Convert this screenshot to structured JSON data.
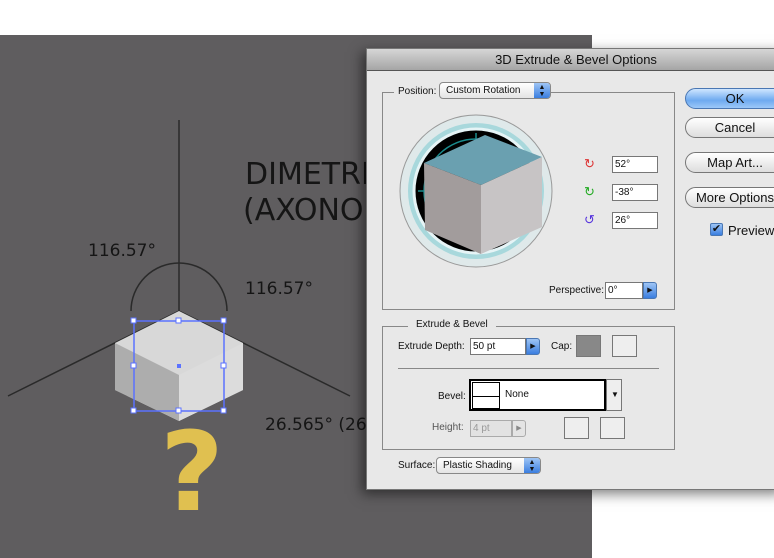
{
  "canvas": {
    "title_line1": "DIMETRI",
    "title_line2": "(AXONO",
    "angle_left": "116.57°",
    "angle_right": "116.57°",
    "angle_bottom": "26.565° (26.",
    "question_mark": "?",
    "question_color": "#e0c050"
  },
  "dialog": {
    "title": "3D Extrude & Bevel Options",
    "position": {
      "label": "Position:",
      "value": "Custom Rotation",
      "x_rotation": "52°",
      "y_rotation": "-38°",
      "z_rotation": "26°",
      "perspective_label": "Perspective:",
      "perspective": "0°"
    },
    "buttons": {
      "ok": "OK",
      "cancel": "Cancel",
      "map_art": "Map Art...",
      "more_options": "More Options"
    },
    "preview": {
      "label": "Preview",
      "checked": true
    },
    "extrude": {
      "group_label": "Extrude & Bevel",
      "depth_label": "Extrude Depth:",
      "depth": "50 pt",
      "cap_label": "Cap:",
      "bevel_label": "Bevel:",
      "bevel": "None",
      "height_label": "Height:",
      "height": "4 pt"
    },
    "surface": {
      "label": "Surface:",
      "value": "Plastic Shading"
    }
  },
  "colors": {
    "accent": "#3a7ee0",
    "canvas": "#5f5d5f",
    "selection": "#5b72ff"
  }
}
